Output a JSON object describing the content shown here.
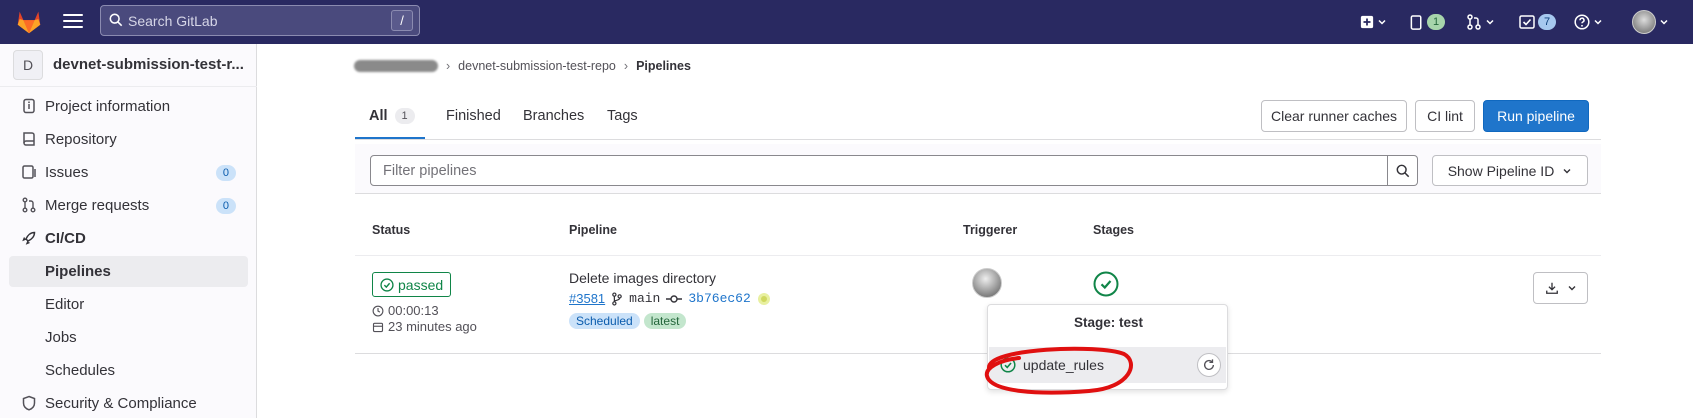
{
  "topbar": {
    "search_placeholder": "Search GitLab",
    "search_shortcut": "/",
    "issues_count": "1",
    "todos_count": "7"
  },
  "sidebar": {
    "project_initial": "D",
    "project_name": "devnet-submission-test-r...",
    "items": [
      {
        "label": "Project information",
        "icon": "info-icon"
      },
      {
        "label": "Repository",
        "icon": "book-icon"
      },
      {
        "label": "Issues",
        "icon": "issues-icon",
        "badge": "0"
      },
      {
        "label": "Merge requests",
        "icon": "merge-request-icon",
        "badge": "0"
      },
      {
        "label": "CI/CD",
        "icon": "rocket-icon"
      },
      {
        "label": "Pipelines"
      },
      {
        "label": "Editor"
      },
      {
        "label": "Jobs"
      },
      {
        "label": "Schedules"
      },
      {
        "label": "Security & Compliance",
        "icon": "shield-icon"
      }
    ]
  },
  "breadcrumb": {
    "repo": "devnet-submission-test-repo",
    "current": "Pipelines"
  },
  "tabs": [
    {
      "label": "All",
      "count": "1"
    },
    {
      "label": "Finished"
    },
    {
      "label": "Branches"
    },
    {
      "label": "Tags"
    }
  ],
  "actions": {
    "clear_caches": "Clear runner caches",
    "ci_lint": "CI lint",
    "run_pipeline": "Run pipeline"
  },
  "filter": {
    "placeholder": "Filter pipelines",
    "show_id": "Show Pipeline ID"
  },
  "table": {
    "headers": {
      "status": "Status",
      "pipeline": "Pipeline",
      "triggerer": "Triggerer",
      "stages": "Stages"
    },
    "row": {
      "status": "passed",
      "duration": "00:00:13",
      "finished": "23 minutes ago",
      "title": "Delete images directory",
      "id": "#3581",
      "branch": "main",
      "sha": "3b76ec62",
      "tags": [
        "Scheduled",
        "latest"
      ]
    }
  },
  "popover": {
    "title": "Stage: test",
    "job": "update_rules"
  },
  "colors": {
    "topbar": "#292961",
    "primary": "#1f75cb",
    "success": "#108548",
    "annotation": "#e01010"
  }
}
